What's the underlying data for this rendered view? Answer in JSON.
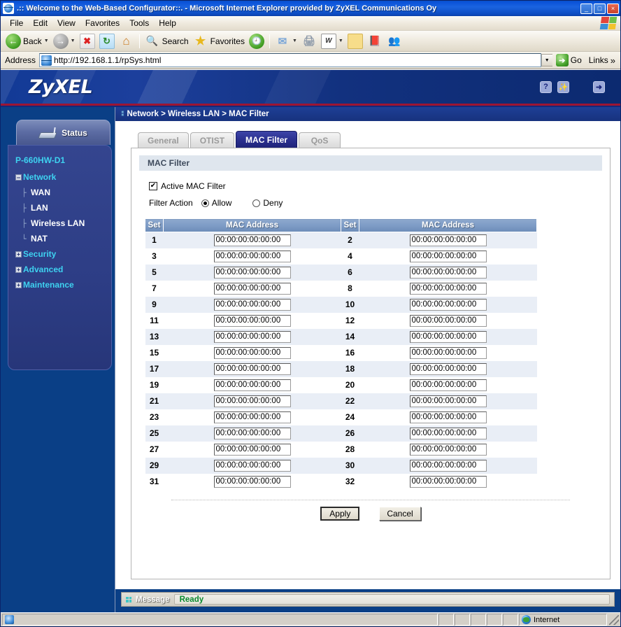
{
  "window": {
    "title": ".:: Welcome to the Web-Based Configurator::. - Microsoft Internet Explorer provided by ZyXEL Communications Oy",
    "minimize_label": "_",
    "maximize_label": "□",
    "close_label": "×"
  },
  "menubar": {
    "items": [
      {
        "label": "File",
        "accel": "F"
      },
      {
        "label": "Edit",
        "accel": "E"
      },
      {
        "label": "View",
        "accel": "V"
      },
      {
        "label": "Favorites",
        "accel": "a"
      },
      {
        "label": "Tools",
        "accel": "T"
      },
      {
        "label": "Help",
        "accel": "H"
      }
    ]
  },
  "toolbar": {
    "back_label": "Back",
    "search_label": "Search",
    "favorites_label": "Favorites",
    "stop_glyph": "✖",
    "refresh_glyph": "↻",
    "home_glyph": "⌂",
    "search_glyph": "🔍",
    "star_glyph": "★",
    "history_glyph": "🕘",
    "mail_glyph": "✉",
    "print_glyph": "🖨",
    "edit_glyph": "W",
    "notes_glyph": "▯",
    "research_glyph": "📕",
    "messenger_glyph": "👥",
    "caret": "▼"
  },
  "address": {
    "label": "Address",
    "value": "http://192.168.1.1/rpSys.html",
    "placeholder": "",
    "dropdown_glyph": "▼",
    "go_label": "Go",
    "go_glyph": "➔",
    "links_label": "Links",
    "links_chevron": "»"
  },
  "banner": {
    "logo": "ZyXEL",
    "help_glyph": "?",
    "wizard_glyph": "✨",
    "logout_glyph": "➜"
  },
  "sidebar": {
    "status_label": "Status",
    "device_model": "P-660HW-D1",
    "items": [
      {
        "label": "Network",
        "expander": "–",
        "level": 0
      },
      {
        "label": "WAN",
        "level": 1,
        "tree": "├"
      },
      {
        "label": "LAN",
        "level": 1,
        "tree": "├"
      },
      {
        "label": "Wireless LAN",
        "level": 1,
        "tree": "├"
      },
      {
        "label": "NAT",
        "level": 1,
        "tree": "└"
      },
      {
        "label": "Security",
        "expander": "+",
        "level": 0
      },
      {
        "label": "Advanced",
        "expander": "+",
        "level": 0
      },
      {
        "label": "Maintenance",
        "expander": "+",
        "level": 0
      }
    ]
  },
  "breadcrumb": {
    "dots": "⁑",
    "text": "Network > Wireless LAN > MAC Filter"
  },
  "tabs": [
    {
      "label": "General",
      "active": false
    },
    {
      "label": "OTIST",
      "active": false
    },
    {
      "label": "MAC Filter",
      "active": true
    },
    {
      "label": "QoS",
      "active": false
    }
  ],
  "panel": {
    "heading": "MAC Filter",
    "active_checkbox_label": "Active MAC Filter",
    "active_checkbox_checked": true,
    "check_glyph": "✔",
    "filter_action_label": "Filter Action",
    "filter_action_options": [
      {
        "label": "Allow",
        "selected": true
      },
      {
        "label": "Deny",
        "selected": false
      }
    ]
  },
  "table": {
    "headers": [
      "Set",
      "MAC Address",
      "Set",
      "MAC Address"
    ],
    "rows": [
      {
        "alt": true,
        "left_set": "1",
        "left_mac": "00:00:00:00:00:00",
        "right_set": "2",
        "right_mac": "00:00:00:00:00:00"
      },
      {
        "alt": false,
        "left_set": "3",
        "left_mac": "00:00:00:00:00:00",
        "right_set": "4",
        "right_mac": "00:00:00:00:00:00"
      },
      {
        "alt": true,
        "left_set": "5",
        "left_mac": "00:00:00:00:00:00",
        "right_set": "6",
        "right_mac": "00:00:00:00:00:00"
      },
      {
        "alt": false,
        "left_set": "7",
        "left_mac": "00:00:00:00:00:00",
        "right_set": "8",
        "right_mac": "00:00:00:00:00:00"
      },
      {
        "alt": true,
        "left_set": "9",
        "left_mac": "00:00:00:00:00:00",
        "right_set": "10",
        "right_mac": "00:00:00:00:00:00"
      },
      {
        "alt": false,
        "left_set": "11",
        "left_mac": "00:00:00:00:00:00",
        "right_set": "12",
        "right_mac": "00:00:00:00:00:00"
      },
      {
        "alt": true,
        "left_set": "13",
        "left_mac": "00:00:00:00:00:00",
        "right_set": "14",
        "right_mac": "00:00:00:00:00:00"
      },
      {
        "alt": false,
        "left_set": "15",
        "left_mac": "00:00:00:00:00:00",
        "right_set": "16",
        "right_mac": "00:00:00:00:00:00"
      },
      {
        "alt": true,
        "left_set": "17",
        "left_mac": "00:00:00:00:00:00",
        "right_set": "18",
        "right_mac": "00:00:00:00:00:00"
      },
      {
        "alt": false,
        "left_set": "19",
        "left_mac": "00:00:00:00:00:00",
        "right_set": "20",
        "right_mac": "00:00:00:00:00:00"
      },
      {
        "alt": true,
        "left_set": "21",
        "left_mac": "00:00:00:00:00:00",
        "right_set": "22",
        "right_mac": "00:00:00:00:00:00"
      },
      {
        "alt": false,
        "left_set": "23",
        "left_mac": "00:00:00:00:00:00",
        "right_set": "24",
        "right_mac": "00:00:00:00:00:00"
      },
      {
        "alt": true,
        "left_set": "25",
        "left_mac": "00:00:00:00:00:00",
        "right_set": "26",
        "right_mac": "00:00:00:00:00:00"
      },
      {
        "alt": false,
        "left_set": "27",
        "left_mac": "00:00:00:00:00:00",
        "right_set": "28",
        "right_mac": "00:00:00:00:00:00"
      },
      {
        "alt": true,
        "left_set": "29",
        "left_mac": "00:00:00:00:00:00",
        "right_set": "30",
        "right_mac": "00:00:00:00:00:00"
      },
      {
        "alt": false,
        "left_set": "31",
        "left_mac": "00:00:00:00:00:00",
        "right_set": "32",
        "right_mac": "00:00:00:00:00:00"
      }
    ]
  },
  "actions": {
    "apply_label": "Apply",
    "cancel_label": "Cancel"
  },
  "message": {
    "label": "Message",
    "value": "Ready"
  },
  "statusbar": {
    "zone_label": "Internet"
  },
  "colors": {
    "accent_blue": "#0a3f86",
    "tab_active": "#2a2f8e",
    "table_header": "#7e9cc6",
    "row_alt": "#e9eef6",
    "message_green": "#0a8a2e",
    "banner_rule_red": "#9d1533"
  }
}
